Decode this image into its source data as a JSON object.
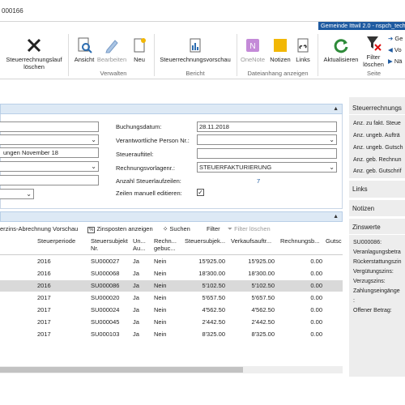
{
  "window": {
    "title": "000166"
  },
  "company_badge": "Gemeinde Ittwil 2.0 - nspch_techn",
  "ribbon": {
    "buttons": {
      "delete": "Steuerrechnungslauf löschen",
      "view": "Ansicht",
      "edit": "Bearbeiten",
      "new": "Neu",
      "tax_invoice_preview": "Steuerrechnungsvorschau",
      "onenote": "OneNote",
      "notes": "Notizen",
      "links": "Links",
      "refresh": "Aktualisieren",
      "clear_filter": "Filter löschen",
      "goto": "Ge",
      "previous": "Vo",
      "next": "Nä"
    },
    "groups": {
      "manage": "Verwalten",
      "report": "Bericht",
      "attachments": "Dateianhang anzeigen",
      "page": "Seite"
    }
  },
  "general": {
    "field_desc_value": "ungen November 18",
    "posting_date_label": "Buchungsdatum:",
    "posting_date_value": "28.11.2018",
    "responsible_label": "Verantwortliche Person Nr.:",
    "responsible_value": "",
    "tax_title_label": "Steuerauftitel:",
    "tax_title_value": "",
    "template_label": "Rechnungsvorlagenr.:",
    "template_value": "STEUERFAKTURIERUNG",
    "line_count_label": "Anzahl Steuerlaufzeilen:",
    "line_count_value": "7",
    "manual_edit_label": "Zeilen manuell editieren:",
    "manual_edit_checked": "✓"
  },
  "lines_toolbar": {
    "preview": "erzins-Abrechnung Vorschau",
    "show_items": "Zinsposten anzeigen",
    "search": "Suchen",
    "filter": "Filter",
    "clear_filter": "Filter löschen"
  },
  "grid": {
    "headers": {
      "period": "Steuerperiode",
      "subject": "Steuersubjekt Nr.",
      "un": "Un... Au...",
      "inv": "Rechn... gebuc...",
      "subj_amt": "Steuersubjek...",
      "sales": "Verkaufsauftr...",
      "inv_amt": "Rechnungsb...",
      "credit": "Gutsc"
    },
    "rows": [
      {
        "period": "2016",
        "subject": "SU000027",
        "un": "Ja",
        "inv": "Nein",
        "subj_amt": "15'925.00",
        "sales": "15'925.00",
        "inv_amt": "0.00"
      },
      {
        "period": "2016",
        "subject": "SU000068",
        "un": "Ja",
        "inv": "Nein",
        "subj_amt": "18'300.00",
        "sales": "18'300.00",
        "inv_amt": "0.00"
      },
      {
        "period": "2016",
        "subject": "SU000086",
        "un": "Ja",
        "inv": "Nein",
        "subj_amt": "5'102.50",
        "sales": "5'102.50",
        "inv_amt": "0.00"
      },
      {
        "period": "2017",
        "subject": "SU000020",
        "un": "Ja",
        "inv": "Nein",
        "subj_amt": "5'657.50",
        "sales": "5'657.50",
        "inv_amt": "0.00"
      },
      {
        "period": "2017",
        "subject": "SU000024",
        "un": "Ja",
        "inv": "Nein",
        "subj_amt": "4'562.50",
        "sales": "4'562.50",
        "inv_amt": "0.00"
      },
      {
        "period": "2017",
        "subject": "SU000045",
        "un": "Ja",
        "inv": "Nein",
        "subj_amt": "2'442.50",
        "sales": "2'442.50",
        "inv_amt": "0.00"
      },
      {
        "period": "2017",
        "subject": "SU000103",
        "un": "Ja",
        "inv": "Nein",
        "subj_amt": "8'325.00",
        "sales": "8'325.00",
        "inv_amt": "0.00"
      }
    ]
  },
  "right_panel": {
    "tax_invoices_title": "Steuerrechnungs",
    "tax_invoices_items": [
      "Anz. zu fakt. Steue",
      "Anz. ungeb. Aufträ",
      "Anz. ungeb. Gutsch",
      "Anz. geb. Rechnun",
      "Anz. geb. Gutschrif"
    ],
    "links_title": "Links",
    "notes_title": "Notizen",
    "interest_title": "Zinswerte",
    "interest_items": [
      "SU000086:",
      "Veranlagungsbetra",
      "Rückerstattungszin",
      "Vergütungszins:",
      "Verzugszins:",
      "Zahlungseingänge",
      ":",
      "Offener Betrag:"
    ]
  }
}
